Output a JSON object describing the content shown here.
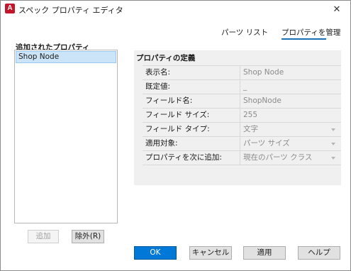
{
  "window": {
    "title": "スペック プロパティ エディタ",
    "app_icon": "A",
    "close_glyph": "✕"
  },
  "tabs": [
    {
      "label": "パーツ リスト",
      "active": false
    },
    {
      "label": "プロパティを管理",
      "active": true
    }
  ],
  "added_properties": {
    "label": "追加されたプロパティ",
    "items": [
      "Shop Node"
    ],
    "selected": "Shop Node",
    "add_button": "追加",
    "remove_button": "除外(R)"
  },
  "definition": {
    "title": "プロパティの定義",
    "rows": [
      {
        "key": "表示名:",
        "value": "Shop Node"
      },
      {
        "key": "既定値:",
        "value": "_"
      },
      {
        "key": "フィールド名:",
        "value": "ShopNode"
      },
      {
        "key": "フィールド サイズ:",
        "value": "255"
      },
      {
        "key": "フィールド タイプ:",
        "value": "文字"
      },
      {
        "key": "適用対象:",
        "value": "パーツ サイズ"
      },
      {
        "key": "プロパティを次に追加:",
        "value": "現在のパーツ クラス"
      }
    ]
  },
  "footer": {
    "ok": "OK",
    "cancel": "キャンセル",
    "apply": "適用",
    "help": "ヘルプ"
  },
  "colors": {
    "accent": "#0078d7",
    "selection": "#cce4f7",
    "brand": "#c4162a"
  }
}
